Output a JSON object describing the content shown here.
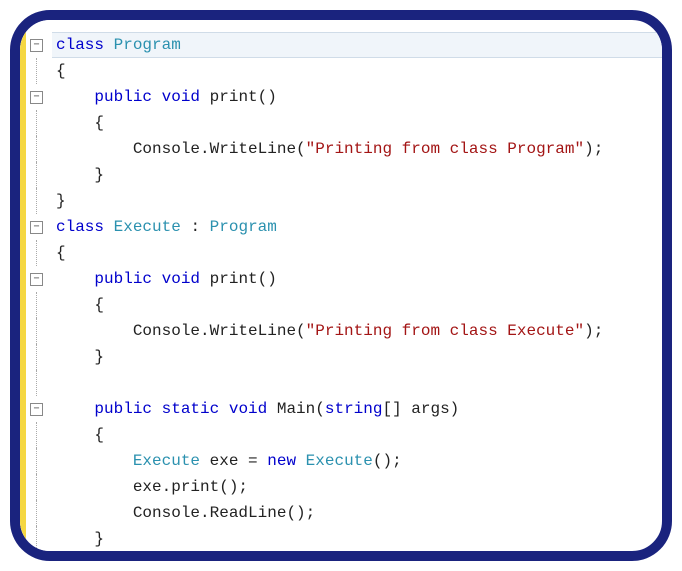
{
  "code": {
    "lines": [
      {
        "fold": "minus",
        "highlight": true,
        "tokens": [
          {
            "t": "kw",
            "v": "class"
          },
          {
            "t": "plain",
            "v": " "
          },
          {
            "t": "type",
            "v": "Program"
          }
        ]
      },
      {
        "fold": "line",
        "tokens": [
          {
            "t": "plain",
            "v": "{"
          }
        ]
      },
      {
        "fold": "minus",
        "tokens": [
          {
            "t": "plain",
            "v": "    "
          },
          {
            "t": "kw",
            "v": "public"
          },
          {
            "t": "plain",
            "v": " "
          },
          {
            "t": "kw",
            "v": "void"
          },
          {
            "t": "plain",
            "v": " print()"
          }
        ]
      },
      {
        "fold": "line",
        "tokens": [
          {
            "t": "plain",
            "v": "    {"
          }
        ]
      },
      {
        "fold": "line",
        "tokens": [
          {
            "t": "plain",
            "v": "        Console.WriteLine("
          },
          {
            "t": "str",
            "v": "\"Printing from class Program\""
          },
          {
            "t": "plain",
            "v": ");"
          }
        ]
      },
      {
        "fold": "line",
        "tokens": [
          {
            "t": "plain",
            "v": "    }"
          }
        ]
      },
      {
        "fold": "end",
        "tokens": [
          {
            "t": "plain",
            "v": "}"
          }
        ]
      },
      {
        "fold": "minus",
        "tokens": [
          {
            "t": "kw",
            "v": "class"
          },
          {
            "t": "plain",
            "v": " "
          },
          {
            "t": "type",
            "v": "Execute"
          },
          {
            "t": "plain",
            "v": " : "
          },
          {
            "t": "type",
            "v": "Program"
          }
        ]
      },
      {
        "fold": "line",
        "tokens": [
          {
            "t": "plain",
            "v": "{"
          }
        ]
      },
      {
        "fold": "minus",
        "tokens": [
          {
            "t": "plain",
            "v": "    "
          },
          {
            "t": "kw",
            "v": "public"
          },
          {
            "t": "plain",
            "v": " "
          },
          {
            "t": "kw",
            "v": "void"
          },
          {
            "t": "plain",
            "v": " print()"
          }
        ]
      },
      {
        "fold": "line",
        "tokens": [
          {
            "t": "plain",
            "v": "    {"
          }
        ]
      },
      {
        "fold": "line",
        "tokens": [
          {
            "t": "plain",
            "v": "        Console.WriteLine("
          },
          {
            "t": "str",
            "v": "\"Printing from class Execute\""
          },
          {
            "t": "plain",
            "v": ");"
          }
        ]
      },
      {
        "fold": "line",
        "tokens": [
          {
            "t": "plain",
            "v": "    }"
          }
        ]
      },
      {
        "fold": "line",
        "tokens": [
          {
            "t": "plain",
            "v": ""
          }
        ]
      },
      {
        "fold": "minus",
        "tokens": [
          {
            "t": "plain",
            "v": "    "
          },
          {
            "t": "kw",
            "v": "public"
          },
          {
            "t": "plain",
            "v": " "
          },
          {
            "t": "kw",
            "v": "static"
          },
          {
            "t": "plain",
            "v": " "
          },
          {
            "t": "kw",
            "v": "void"
          },
          {
            "t": "plain",
            "v": " Main("
          },
          {
            "t": "kw",
            "v": "string"
          },
          {
            "t": "plain",
            "v": "[] args)"
          }
        ]
      },
      {
        "fold": "line",
        "tokens": [
          {
            "t": "plain",
            "v": "    {"
          }
        ]
      },
      {
        "fold": "line",
        "tokens": [
          {
            "t": "plain",
            "v": "        "
          },
          {
            "t": "type",
            "v": "Execute"
          },
          {
            "t": "plain",
            "v": " exe = "
          },
          {
            "t": "kw",
            "v": "new"
          },
          {
            "t": "plain",
            "v": " "
          },
          {
            "t": "type",
            "v": "Execute"
          },
          {
            "t": "plain",
            "v": "();"
          }
        ]
      },
      {
        "fold": "line",
        "tokens": [
          {
            "t": "plain",
            "v": "        exe.print();"
          }
        ]
      },
      {
        "fold": "line",
        "tokens": [
          {
            "t": "plain",
            "v": "        Console.ReadLine();"
          }
        ]
      },
      {
        "fold": "line",
        "tokens": [
          {
            "t": "plain",
            "v": "    }"
          }
        ]
      },
      {
        "fold": "end",
        "tokens": [
          {
            "t": "plain",
            "v": "}"
          }
        ]
      }
    ]
  },
  "fold_symbol": "−"
}
